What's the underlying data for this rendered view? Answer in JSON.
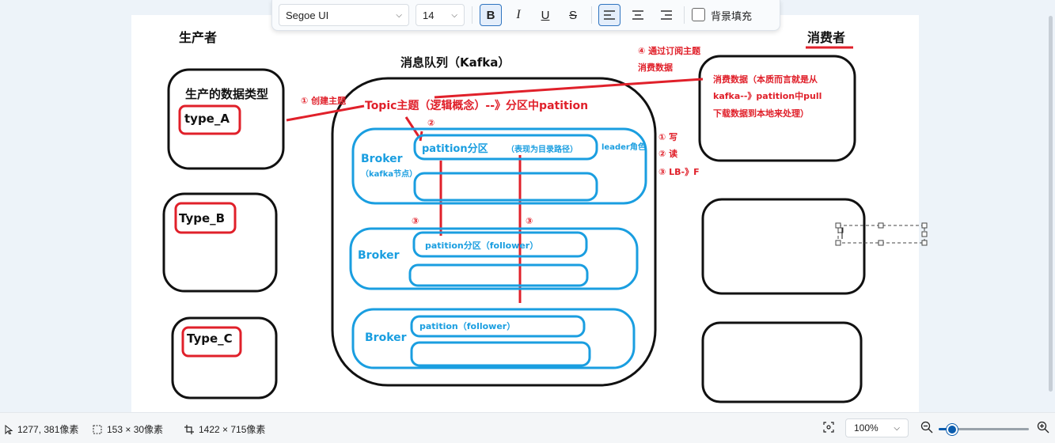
{
  "toolbar": {
    "font_family": "Segoe UI",
    "font_size": "14",
    "bold_label": "B",
    "italic_label": "I",
    "underline_label": "U",
    "strike_label": "S",
    "fill_label": "背景填充"
  },
  "diagram": {
    "producer_title": "生产者",
    "consumer_title": "消费者",
    "queue_title": "消息队列（Kafka）",
    "data_type_label": "生产的数据类型",
    "type_a": "type_A",
    "type_b": "Type_B",
    "type_c": "Type_C",
    "create_topic": "① 创建主题",
    "topic": "Topic主题（逻辑概念）--》分区中patition",
    "subscribe_line1": "④ 通过订阅主题",
    "subscribe_line2": "消费数据",
    "consume_line1": "消费数据（本质而言就是从",
    "consume_line2": "kafka--》patition中pull",
    "consume_line3": "下载数据到本地来处理）",
    "step2": "②",
    "step3a": "③",
    "step3b": "③",
    "broker1": "Broker",
    "broker1_sub": "（kafka节点）",
    "broker2": "Broker",
    "broker3": "Broker",
    "partition_leader": "patition分区",
    "partition_leader_note": "（表现为目录路径）",
    "leader_role": "leader角色",
    "partition_follower1": "patition分区（follower）",
    "partition_follower2": "patition（follower）",
    "rw_write": "① 写",
    "rw_read": "② 读",
    "rw_lb": "③ LB-》F"
  },
  "statusbar": {
    "cursor_pos": "1277, 381像素",
    "selection_size": "153 × 30像素",
    "image_size": "1422 × 715像素",
    "zoom": "100%"
  },
  "colors": {
    "red": "#e0202a",
    "blue": "#1a9ee0",
    "black": "#111111",
    "accent": "#0b5cad"
  },
  "zoom_level": 0.15
}
